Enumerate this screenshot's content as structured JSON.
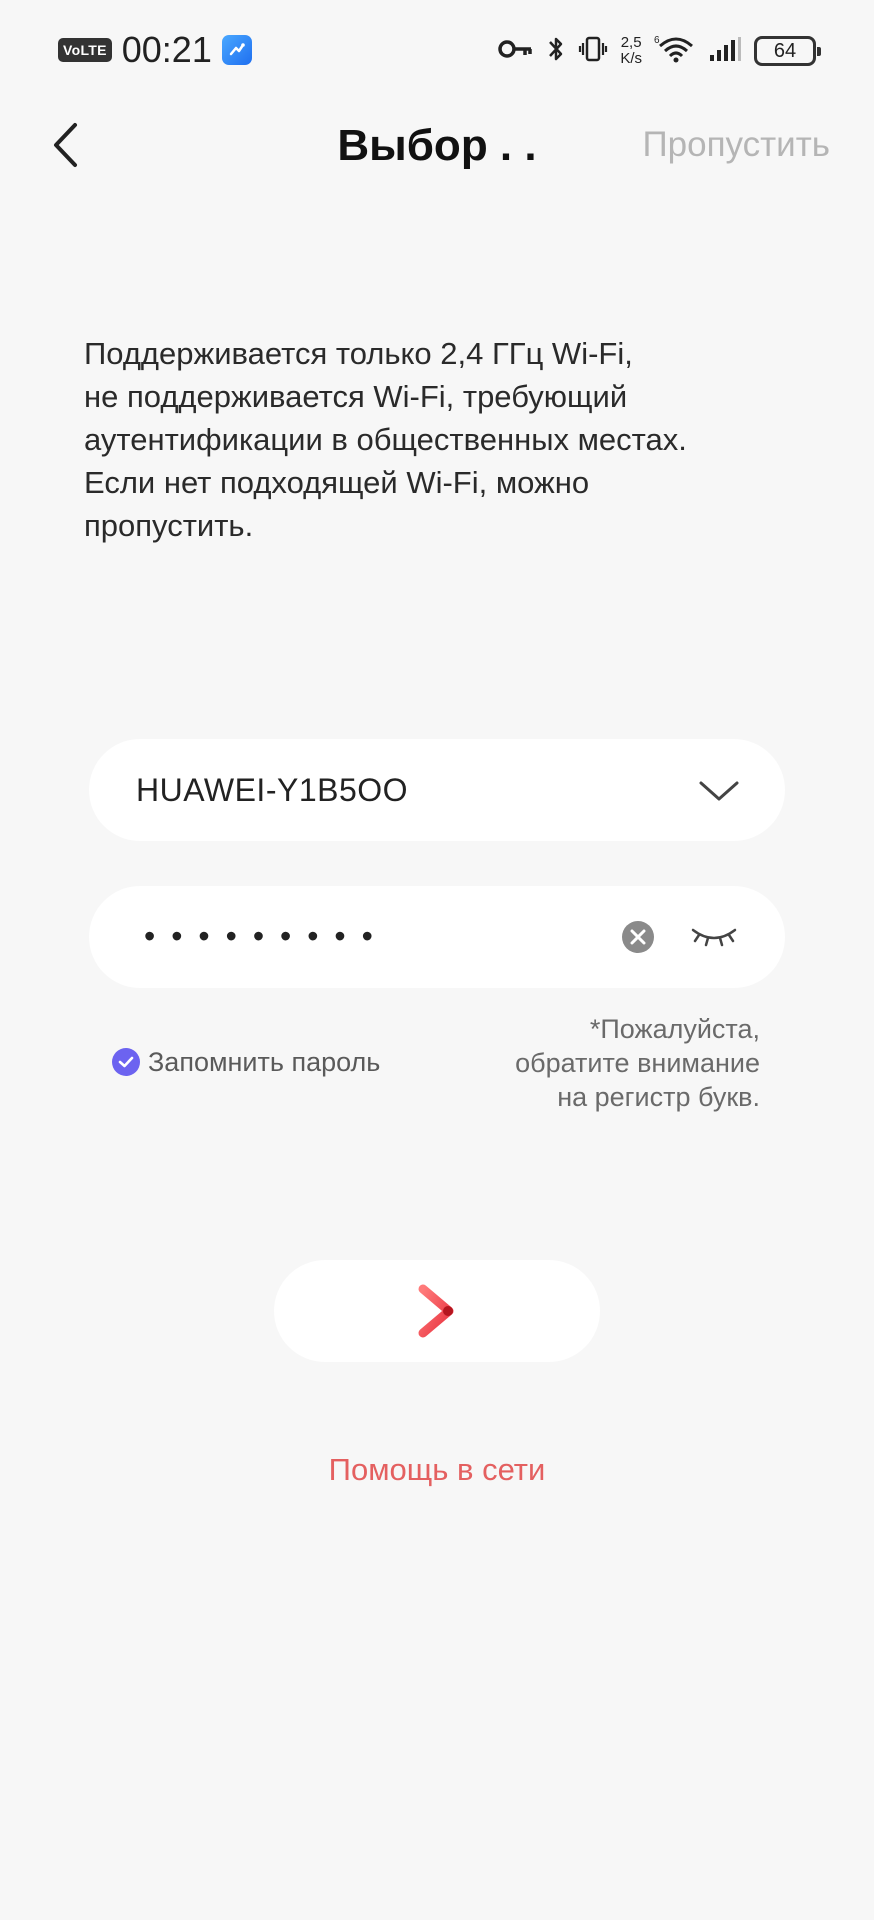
{
  "status_bar": {
    "volte": "VoLTE",
    "time": "00:21",
    "net_speed_value": "2,5",
    "net_speed_unit": "K/s",
    "battery": "64"
  },
  "header": {
    "title": "Выбор . .",
    "skip_label": "Пропустить"
  },
  "info": {
    "text": "Поддерживается только 2,4 ГГц Wi-Fi,\nне поддерживается Wi-Fi, требующий\nаутентификации в общественных местах.\nЕсли нет подходящей Wi-Fi, можно\nпропустить."
  },
  "form": {
    "wifi_name": "HUAWEI-Y1B5OO",
    "password_masked": "•••••••••",
    "remember_label": "Запомнить пароль",
    "remember_checked": true,
    "case_note": "*Пожалуйста,\nобратите внимание\nна регистр букв."
  },
  "actions": {
    "help_label": "Помощь в сети"
  },
  "colors": {
    "accent": "#6c63f0",
    "next_arrow": "#f0505a",
    "help_text": "#e46060",
    "skip_text": "#b5b5b5"
  }
}
